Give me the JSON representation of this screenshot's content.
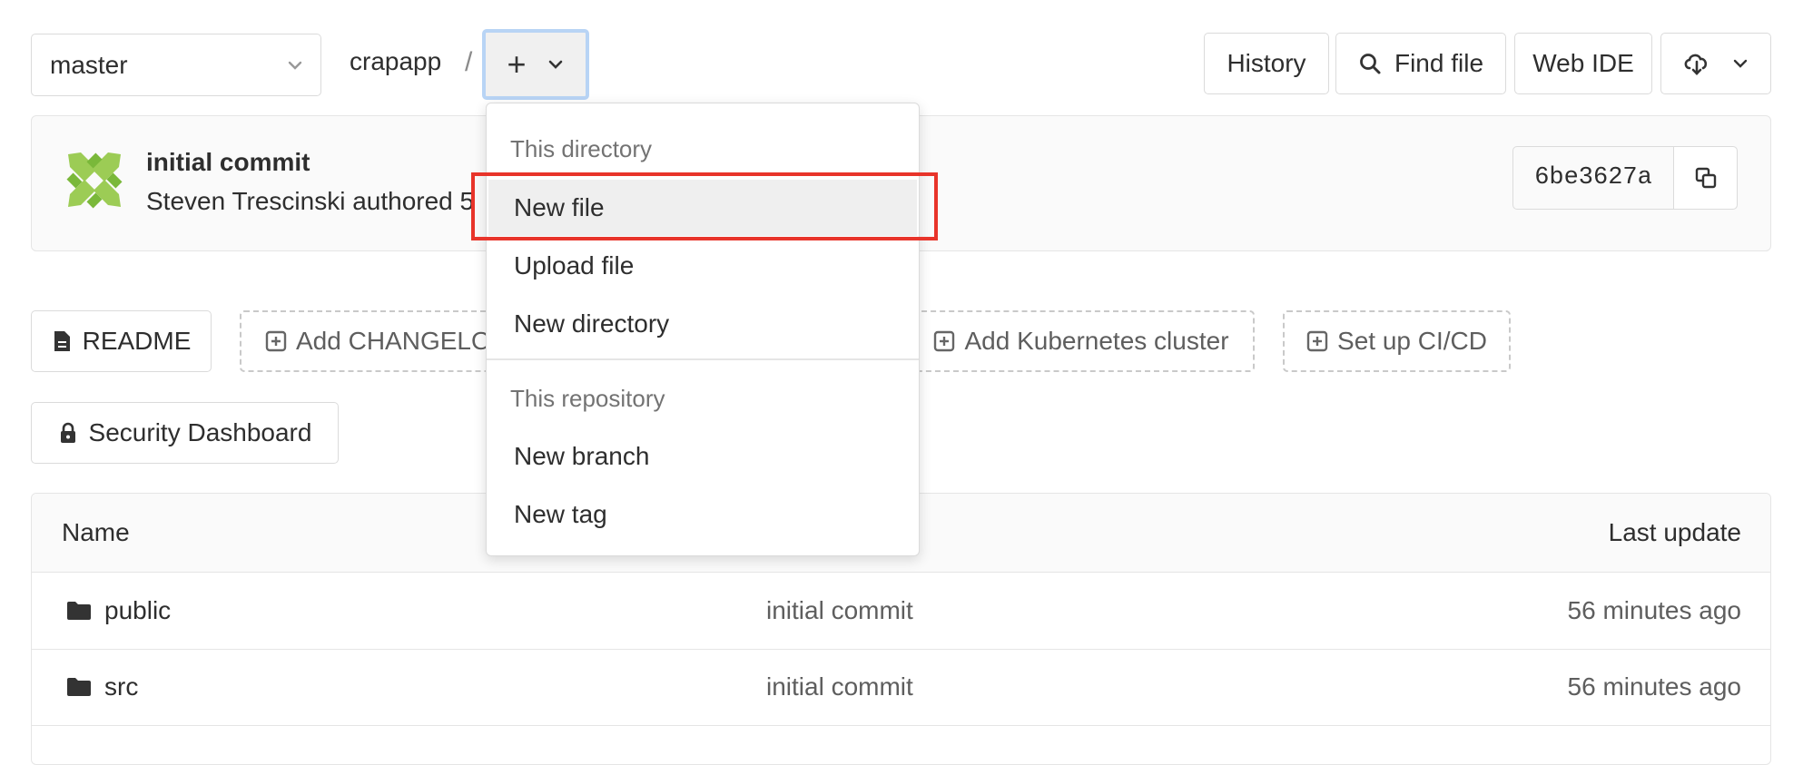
{
  "toolbar": {
    "branch": "master",
    "breadcrumb_project": "crapapp",
    "breadcrumb_sep": "/",
    "add_button": "+",
    "history": "History",
    "find_file": "Find file",
    "web_ide": "Web IDE"
  },
  "commit": {
    "title": "initial commit",
    "author_line": "Steven Trescinski authored 5",
    "sha": "6be3627a"
  },
  "quick_actions": {
    "readme": "README",
    "add_changelog": "Add CHANGELO",
    "add_kubernetes": "Add Kubernetes cluster",
    "setup_cicd": "Set up CI/CD",
    "security_dashboard": "Security Dashboard"
  },
  "table": {
    "col_name": "Name",
    "col_last_update": "Last update",
    "rows": [
      {
        "name": "public",
        "commit": "initial commit",
        "updated": "56 minutes ago"
      },
      {
        "name": "src",
        "commit": "initial commit",
        "updated": "56 minutes ago"
      }
    ]
  },
  "dropdown": {
    "section_directory": "This directory",
    "new_file": "New file",
    "upload_file": "Upload file",
    "new_directory": "New directory",
    "section_repository": "This repository",
    "new_branch": "New branch",
    "new_tag": "New tag"
  },
  "colors": {
    "highlight": "#e8342a",
    "avatar_green": "#8cc63f",
    "focus_ring": "#b8d4f5"
  }
}
